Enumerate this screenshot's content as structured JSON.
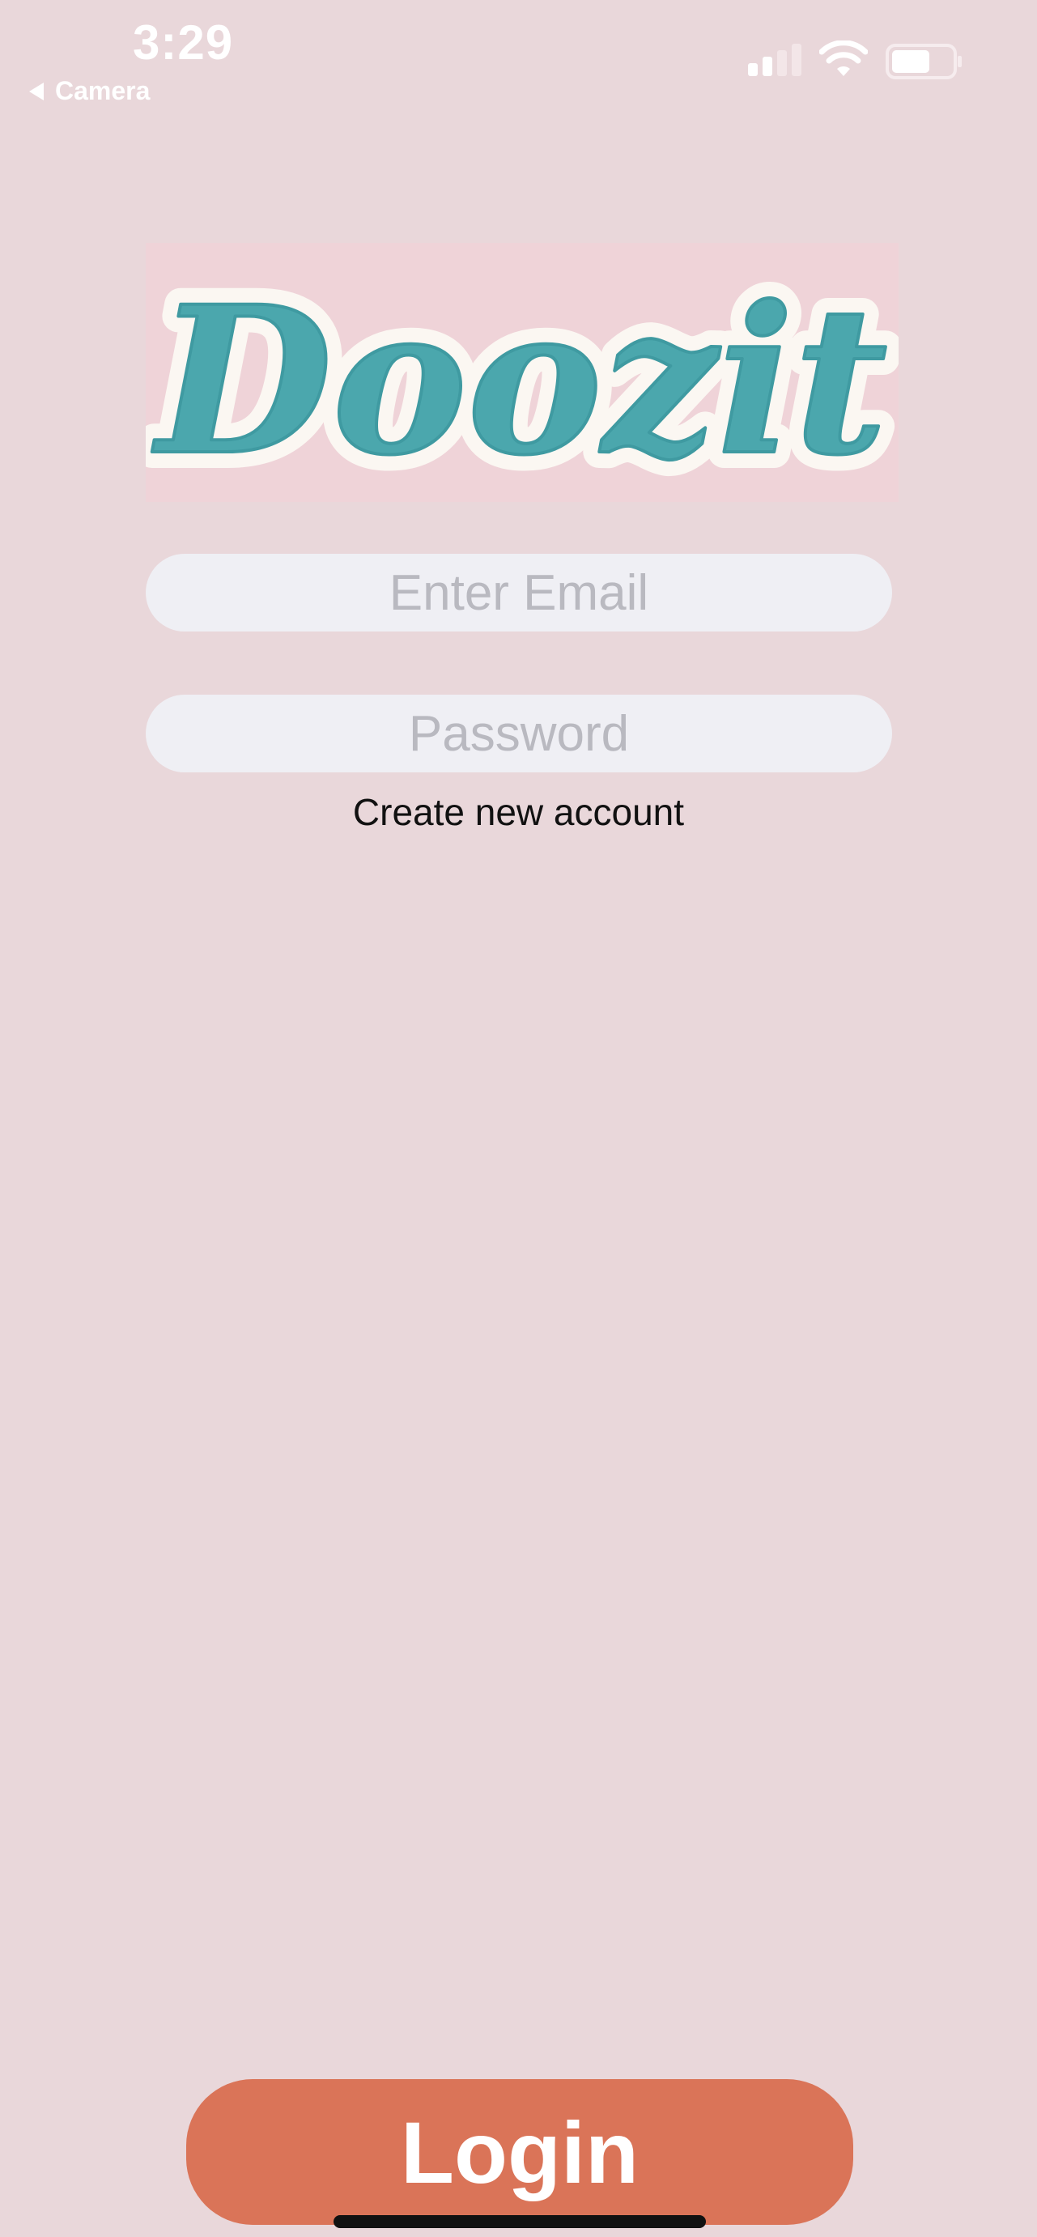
{
  "status_bar": {
    "time": "3:29",
    "back_label": "Camera",
    "icons": [
      "signal-icon",
      "wifi-icon",
      "battery-icon"
    ]
  },
  "logo": {
    "text": "Doozit",
    "color": "#4ba7ad",
    "outline_color": "#fbf7f2"
  },
  "form": {
    "email_placeholder": "Enter Email",
    "email_value": "",
    "password_placeholder": "Password",
    "password_value": "",
    "create_account_label": "Create new account"
  },
  "login_button": {
    "label": "Login",
    "color": "#da7458"
  },
  "colors": {
    "background": "#e9d7da",
    "field_background": "#efeff4",
    "placeholder": "#b9b9c0"
  }
}
